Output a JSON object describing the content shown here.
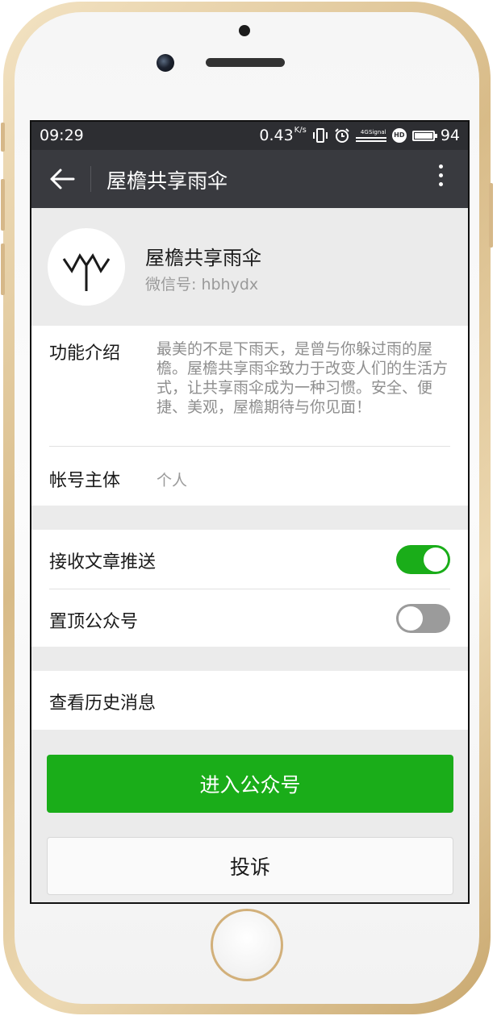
{
  "status_bar": {
    "time": "09:29",
    "net_speed": "0.43",
    "net_speed_unit": "K/s",
    "network_label": "4G",
    "signal_label": "Signal",
    "hd_label": "HD",
    "battery_level": "94"
  },
  "header": {
    "title": "屋檐共享雨伞"
  },
  "profile": {
    "name": "屋檐共享雨伞",
    "wechat_id": "微信号: hbhydx"
  },
  "info": {
    "intro_label": "功能介绍",
    "intro_text": "最美的不是下雨天，是曾与你躲过雨的屋檐。屋檐共享雨伞致力于改变人们的生活方式，让共享雨伞成为一种习惯。安全、便捷、美观，屋檐期待与你见面！",
    "subject_label": "帐号主体",
    "subject_value": "个人"
  },
  "settings": {
    "receive_push_label": "接收文章推送",
    "receive_push_on": true,
    "pin_label": "置顶公众号",
    "pin_on": false
  },
  "history": {
    "label": "查看历史消息"
  },
  "actions": {
    "enter_label": "进入公众号",
    "complain_label": "投诉"
  },
  "colors": {
    "accent_green": "#1aad19",
    "titlebar": "#393a3f",
    "statusbar": "#2d2e32",
    "page_bg": "#ebebeb",
    "frame_gold": "#d8bb88"
  }
}
